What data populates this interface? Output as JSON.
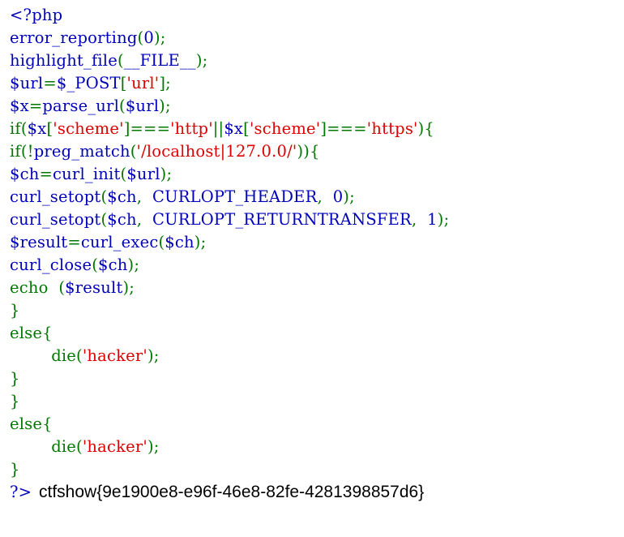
{
  "colors": {
    "html": "#000000",
    "default": "#0000bb",
    "keyword": "#007700",
    "string": "#dd0000"
  },
  "code_lines": [
    [
      [
        "default",
        "<?php"
      ]
    ],
    [
      [
        "default",
        "error_reporting"
      ],
      [
        "keyword",
        "("
      ],
      [
        "default",
        "0"
      ],
      [
        "keyword",
        ");"
      ]
    ],
    [
      [
        "default",
        "highlight_file"
      ],
      [
        "keyword",
        "("
      ],
      [
        "default",
        "__FILE__"
      ],
      [
        "keyword",
        ");"
      ]
    ],
    [
      [
        "default",
        "$url"
      ],
      [
        "keyword",
        "="
      ],
      [
        "default",
        "$_POST"
      ],
      [
        "keyword",
        "["
      ],
      [
        "string",
        "'url'"
      ],
      [
        "keyword",
        "];"
      ]
    ],
    [
      [
        "default",
        "$x"
      ],
      [
        "keyword",
        "="
      ],
      [
        "default",
        "parse_url"
      ],
      [
        "keyword",
        "("
      ],
      [
        "default",
        "$url"
      ],
      [
        "keyword",
        ");"
      ]
    ],
    [
      [
        "keyword",
        "if("
      ],
      [
        "default",
        "$x"
      ],
      [
        "keyword",
        "["
      ],
      [
        "string",
        "'scheme'"
      ],
      [
        "keyword",
        "]==="
      ],
      [
        "string",
        "'http'"
      ],
      [
        "keyword",
        "||"
      ],
      [
        "default",
        "$x"
      ],
      [
        "keyword",
        "["
      ],
      [
        "string",
        "'scheme'"
      ],
      [
        "keyword",
        "]==="
      ],
      [
        "string",
        "'https'"
      ],
      [
        "keyword",
        "){"
      ]
    ],
    [
      [
        "keyword",
        "if(!"
      ],
      [
        "default",
        "preg_match"
      ],
      [
        "keyword",
        "("
      ],
      [
        "string",
        "'/localhost|127.0.0/'"
      ],
      [
        "keyword",
        ")){"
      ]
    ],
    [
      [
        "default",
        "$ch"
      ],
      [
        "keyword",
        "="
      ],
      [
        "default",
        "curl_init"
      ],
      [
        "keyword",
        "("
      ],
      [
        "default",
        "$url"
      ],
      [
        "keyword",
        ");"
      ]
    ],
    [
      [
        "default",
        "curl_setopt"
      ],
      [
        "keyword",
        "("
      ],
      [
        "default",
        "$ch"
      ],
      [
        "keyword",
        ",  "
      ],
      [
        "default",
        "CURLOPT_HEADER"
      ],
      [
        "keyword",
        ",  "
      ],
      [
        "default",
        "0"
      ],
      [
        "keyword",
        ");"
      ]
    ],
    [
      [
        "default",
        "curl_setopt"
      ],
      [
        "keyword",
        "("
      ],
      [
        "default",
        "$ch"
      ],
      [
        "keyword",
        ",  "
      ],
      [
        "default",
        "CURLOPT_RETURNTRANSFER"
      ],
      [
        "keyword",
        ",  "
      ],
      [
        "default",
        "1"
      ],
      [
        "keyword",
        ");"
      ]
    ],
    [
      [
        "default",
        "$result"
      ],
      [
        "keyword",
        "="
      ],
      [
        "default",
        "curl_exec"
      ],
      [
        "keyword",
        "("
      ],
      [
        "default",
        "$ch"
      ],
      [
        "keyword",
        ");"
      ]
    ],
    [
      [
        "default",
        "curl_close"
      ],
      [
        "keyword",
        "("
      ],
      [
        "default",
        "$ch"
      ],
      [
        "keyword",
        ");"
      ]
    ],
    [
      [
        "keyword",
        "echo  ("
      ],
      [
        "default",
        "$result"
      ],
      [
        "keyword",
        ");"
      ]
    ],
    [
      [
        "keyword",
        "}"
      ]
    ],
    [
      [
        "keyword",
        "else{"
      ]
    ],
    [
      [
        "keyword",
        "        die("
      ],
      [
        "string",
        "'hacker'"
      ],
      [
        "keyword",
        ");"
      ]
    ],
    [
      [
        "keyword",
        "}"
      ]
    ],
    [
      [
        "keyword",
        "}"
      ]
    ],
    [
      [
        "keyword",
        "else{"
      ]
    ],
    [
      [
        "keyword",
        "        die("
      ],
      [
        "string",
        "'hacker'"
      ],
      [
        "keyword",
        ");"
      ]
    ],
    [
      [
        "keyword",
        "}"
      ]
    ],
    [
      [
        "default",
        "?>"
      ]
    ]
  ],
  "output": {
    "text": "ctfshow{9e1900e8-e96f-46e8-82fe-4281398857d6}"
  }
}
